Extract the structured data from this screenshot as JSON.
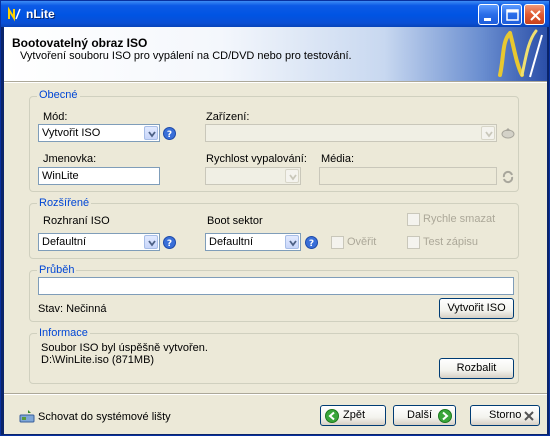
{
  "window": {
    "title": "nLite"
  },
  "header": {
    "title": "Bootovatelný obraz ISO",
    "subtitle": "Vytvoření souboru ISO pro vypálení na CD/DVD nebo pro testování."
  },
  "general": {
    "label": "Obecné",
    "mode_label": "Mód:",
    "mode_value": "Vytvořit ISO",
    "device_label": "Zařízení:",
    "device_value": "",
    "volume_label": "Jmenovka:",
    "volume_value": "WinLite",
    "burn_speed_label": "Rychlost vypalování:",
    "burn_speed_value": "",
    "media_label": "Média:",
    "media_value": ""
  },
  "advanced": {
    "label": "Rozšířené",
    "iso_interface_label": "Rozhraní ISO",
    "iso_interface_value": "Defaultní",
    "boot_sector_label": "Boot sektor",
    "boot_sector_value": "Defaultní",
    "verify_label": "Ověřit",
    "quick_erase_label": "Rychle smazat",
    "test_write_label": "Test zápisu"
  },
  "progress": {
    "label": "Průběh",
    "value": 0,
    "status_text": "Stav: Nečinná",
    "create_iso_button": "Vytvořit ISO"
  },
  "info": {
    "label": "Informace",
    "line1": "Soubor ISO byl úspěšně vytvořen.",
    "line2": "D:\\WinLite.iso (871MB)",
    "expand_button": "Rozbalit"
  },
  "footer": {
    "hide_to_tray": "Schovat do systémové lišty",
    "back_button": "Zpět",
    "next_button": "Další",
    "cancel_button": "Storno"
  }
}
